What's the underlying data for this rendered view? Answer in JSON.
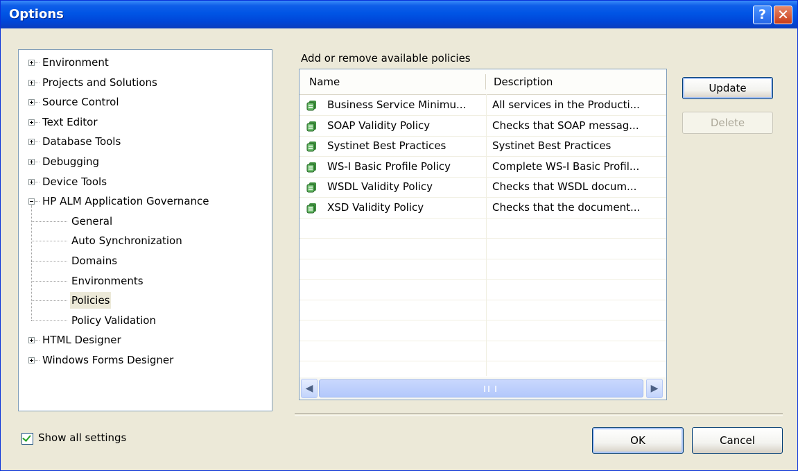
{
  "window": {
    "title": "Options",
    "help_glyph": "?",
    "close_glyph": "✕"
  },
  "tree": {
    "nodes": [
      {
        "label": "Environment",
        "level": 0,
        "expander": "plus"
      },
      {
        "label": "Projects and Solutions",
        "level": 0,
        "expander": "plus"
      },
      {
        "label": "Source Control",
        "level": 0,
        "expander": "plus"
      },
      {
        "label": "Text Editor",
        "level": 0,
        "expander": "plus"
      },
      {
        "label": "Database Tools",
        "level": 0,
        "expander": "plus"
      },
      {
        "label": "Debugging",
        "level": 0,
        "expander": "plus"
      },
      {
        "label": "Device Tools",
        "level": 0,
        "expander": "plus"
      },
      {
        "label": "HP ALM Application Governance",
        "level": 0,
        "expander": "minus"
      },
      {
        "label": "General",
        "level": 1
      },
      {
        "label": "Auto Synchronization",
        "level": 1
      },
      {
        "label": "Domains",
        "level": 1
      },
      {
        "label": "Environments",
        "level": 1
      },
      {
        "label": "Policies",
        "level": 1,
        "selected": true
      },
      {
        "label": "Policy Validation",
        "level": 1
      },
      {
        "label": "HTML Designer",
        "level": 0,
        "expander": "plus"
      },
      {
        "label": "Windows Forms Designer",
        "level": 0,
        "expander": "plus"
      }
    ]
  },
  "policies": {
    "section_label": "Add or remove available policies",
    "columns": [
      "Name",
      "Description"
    ],
    "rows": [
      {
        "name": "Business Service Minimu...",
        "description": "All services in the Producti..."
      },
      {
        "name": "SOAP Validity Policy",
        "description": "Checks that SOAP messag..."
      },
      {
        "name": "Systinet Best Practices",
        "description": "Systinet Best Practices"
      },
      {
        "name": "WS-I Basic Profile Policy",
        "description": "Complete WS-I Basic Profil..."
      },
      {
        "name": "WSDL Validity Policy",
        "description": "Checks that WSDL docum..."
      },
      {
        "name": "XSD Validity Policy",
        "description": "Checks that the document..."
      }
    ],
    "row_icon": "policy-icon",
    "scroll_left": "◀",
    "scroll_right": "▶"
  },
  "buttons": {
    "update": "Update",
    "delete": "Delete",
    "ok": "OK",
    "cancel": "Cancel"
  },
  "show_all_settings": {
    "label": "Show all settings",
    "checked": true
  },
  "colors": {
    "title_bar": "#0055e5",
    "selection": "#ece9d8",
    "dialog_bg": "#ece9d8",
    "border": "#7f9db9"
  }
}
